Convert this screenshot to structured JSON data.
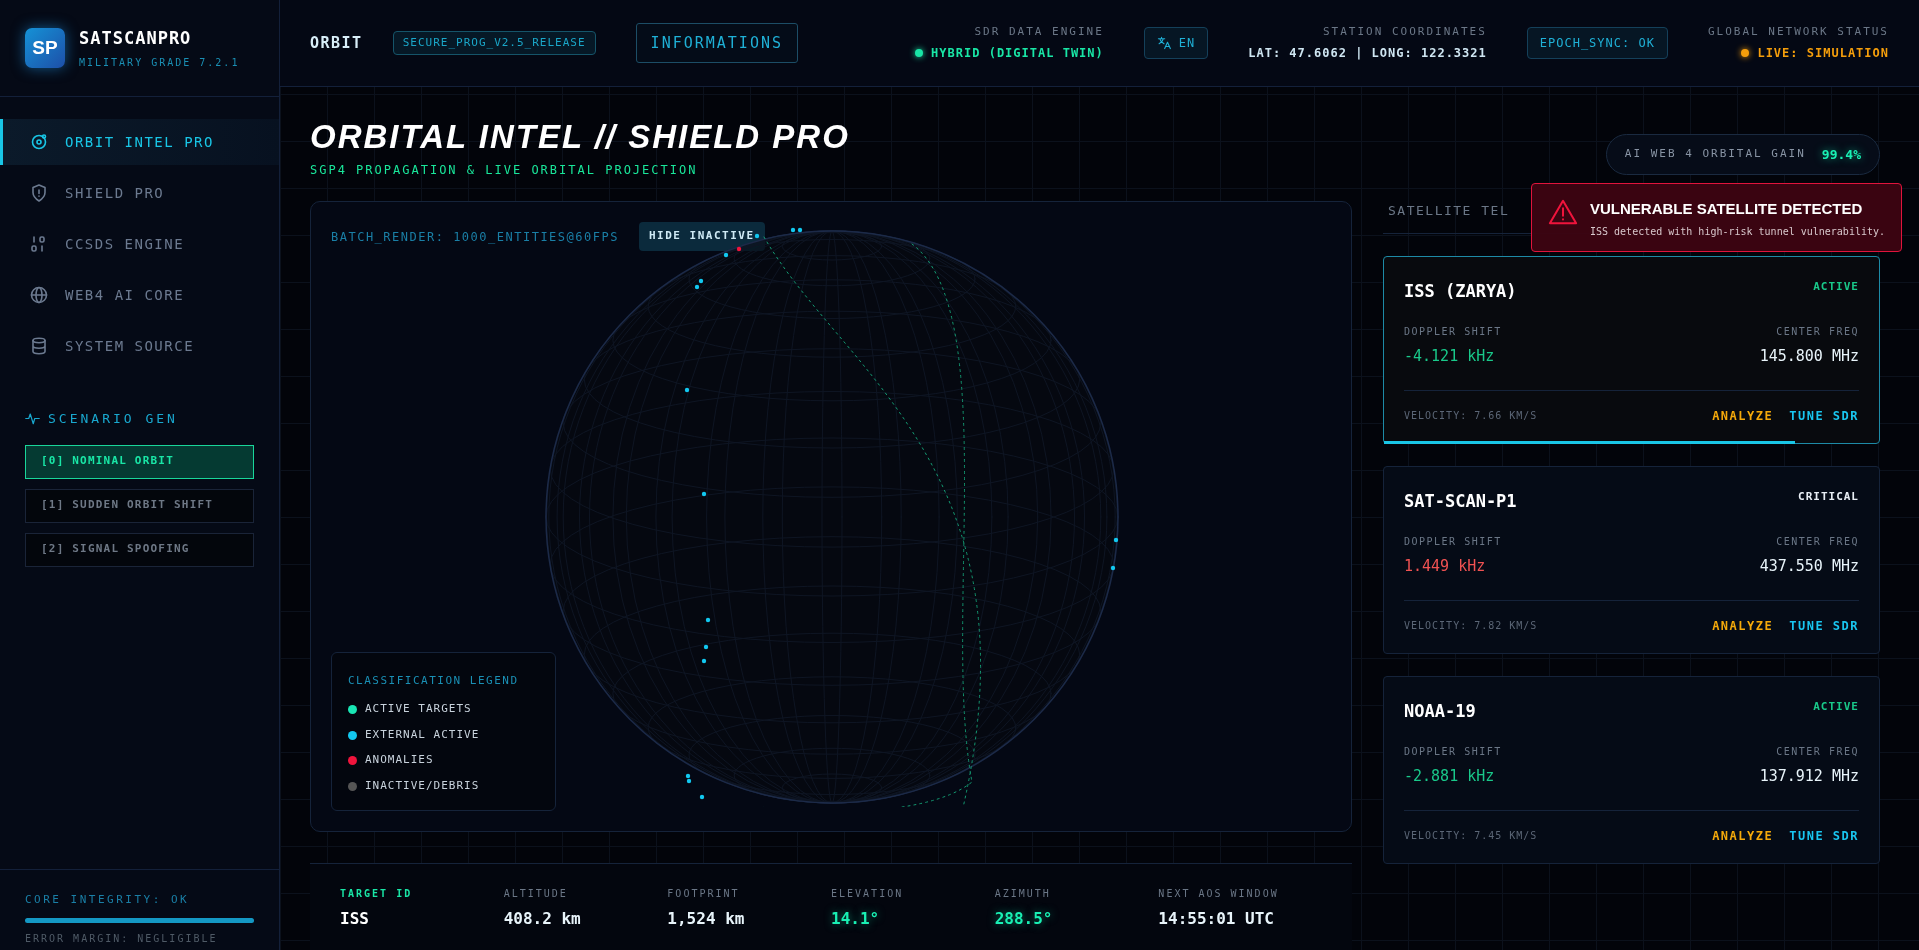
{
  "brand": {
    "logo": "SP",
    "name": "SATSCANPRO",
    "version": "MILITARY GRADE 7.2.1"
  },
  "sidebar": {
    "items": [
      {
        "label": "ORBIT INTEL PRO",
        "selected": true
      },
      {
        "label": "SHIELD PRO",
        "selected": false
      },
      {
        "label": "CCSDS ENGINE",
        "selected": false
      },
      {
        "label": "WEB4 AI CORE",
        "selected": false
      },
      {
        "label": "SYSTEM SOURCE",
        "selected": false
      }
    ],
    "scenario_title": "SCENARIO GEN",
    "scenarios": [
      {
        "label": "[0] NOMINAL ORBIT",
        "selected": true
      },
      {
        "label": "[1] SUDDEN ORBIT SHIFT",
        "selected": false
      },
      {
        "label": "[2] SIGNAL SPOOFING",
        "selected": false
      }
    ],
    "footer": {
      "status": "CORE INTEGRITY: OK",
      "level": 1,
      "note": "ERROR MARGIN: NEGLIGIBLE"
    }
  },
  "header": {
    "section": "ORBIT",
    "release_tag": "SECURE_PROG_V2.5_RELEASE",
    "info_button": "INFORMATIONS",
    "sdr": {
      "label": "SDR DATA ENGINE",
      "value": "HYBRID (DIGITAL TWIN)",
      "color": "#19e6a6"
    },
    "language": "EN",
    "coords": {
      "label": "STATION COORDINATES",
      "value": "LAT: 47.6062 | LONG: 122.3321"
    },
    "epoch": "EPOCH_SYNC: OK",
    "network": {
      "label": "GLOBAL NETWORK STATUS",
      "value": "LIVE: SIMULATION",
      "color": "#f59e0b"
    }
  },
  "title": "ORBITAL INTEL // SHIELD PRO",
  "subtitle": "SGP4 PROPAGATION & LIVE ORBITAL PROJECTION",
  "gain": {
    "label": "AI WEB 4 ORBITAL GAIN",
    "value": "99.4%"
  },
  "globe_panel": {
    "render_info": "BATCH_RENDER: 1000_ENTITIES@60FPS",
    "hide_button": "HIDE INACTIVE",
    "legend": {
      "title": "CLASSIFICATION LEGEND",
      "items": [
        {
          "label": "ACTIVE TARGETS",
          "color": "#19e6b4"
        },
        {
          "label": "EXTERNAL ACTIVE",
          "color": "#12c8f0"
        },
        {
          "label": "ANOMALIES",
          "color": "#f0143c"
        },
        {
          "label": "INACTIVE/DEBRIS",
          "color": "#555555"
        }
      ]
    }
  },
  "stats": [
    {
      "kind": "target",
      "label": "TARGET ID",
      "value": "ISS"
    },
    {
      "kind": "plain",
      "label": "ALTITUDE",
      "value": "408.2 km"
    },
    {
      "kind": "plain",
      "label": "FOOTPRINT",
      "value": "1,524 km"
    },
    {
      "kind": "angle",
      "label": "ELEVATION",
      "value": "14.1°"
    },
    {
      "kind": "angle",
      "label": "AZIMUTH",
      "value": "288.5°"
    },
    {
      "kind": "plain",
      "label": "NEXT AOS WINDOW",
      "value": "14:55:01 UTC"
    }
  ],
  "telemetry": {
    "heading": "SATELLITE TEL",
    "alert": {
      "title": "VULNERABLE SATELLITE DETECTED",
      "message": "ISS detected with high-risk tunnel vulnerability."
    },
    "satellites": [
      {
        "name": "ISS (ZARYA)",
        "status": "ACTIVE",
        "kind": "active",
        "selected": true,
        "level": 0.83,
        "doppler_label": "DOPPLER SHIFT",
        "doppler": "-4.121 kHz",
        "freq_label": "CENTER FREQ",
        "freq": "145.800 MHz",
        "velocity": "VELOCITY: 7.66 KM/S",
        "analyze": "ANALYZE",
        "tune": "TUNE SDR"
      },
      {
        "name": "SAT-SCAN-P1",
        "status": "CRITICAL",
        "kind": "critical",
        "selected": false,
        "doppler_label": "DOPPLER SHIFT",
        "doppler": "1.449 kHz",
        "freq_label": "CENTER FREQ",
        "freq": "437.550 MHz",
        "velocity": "VELOCITY: 7.82 KM/S",
        "analyze": "ANALYZE",
        "tune": "TUNE SDR"
      },
      {
        "name": "NOAA-19",
        "status": "ACTIVE",
        "kind": "active",
        "selected": false,
        "doppler_label": "DOPPLER SHIFT",
        "doppler": "-2.881 kHz",
        "freq_label": "CENTER FREQ",
        "freq": "137.912 MHz",
        "velocity": "VELOCITY: 7.45 KM/S",
        "analyze": "ANALYZE",
        "tune": "TUNE SDR"
      }
    ]
  }
}
